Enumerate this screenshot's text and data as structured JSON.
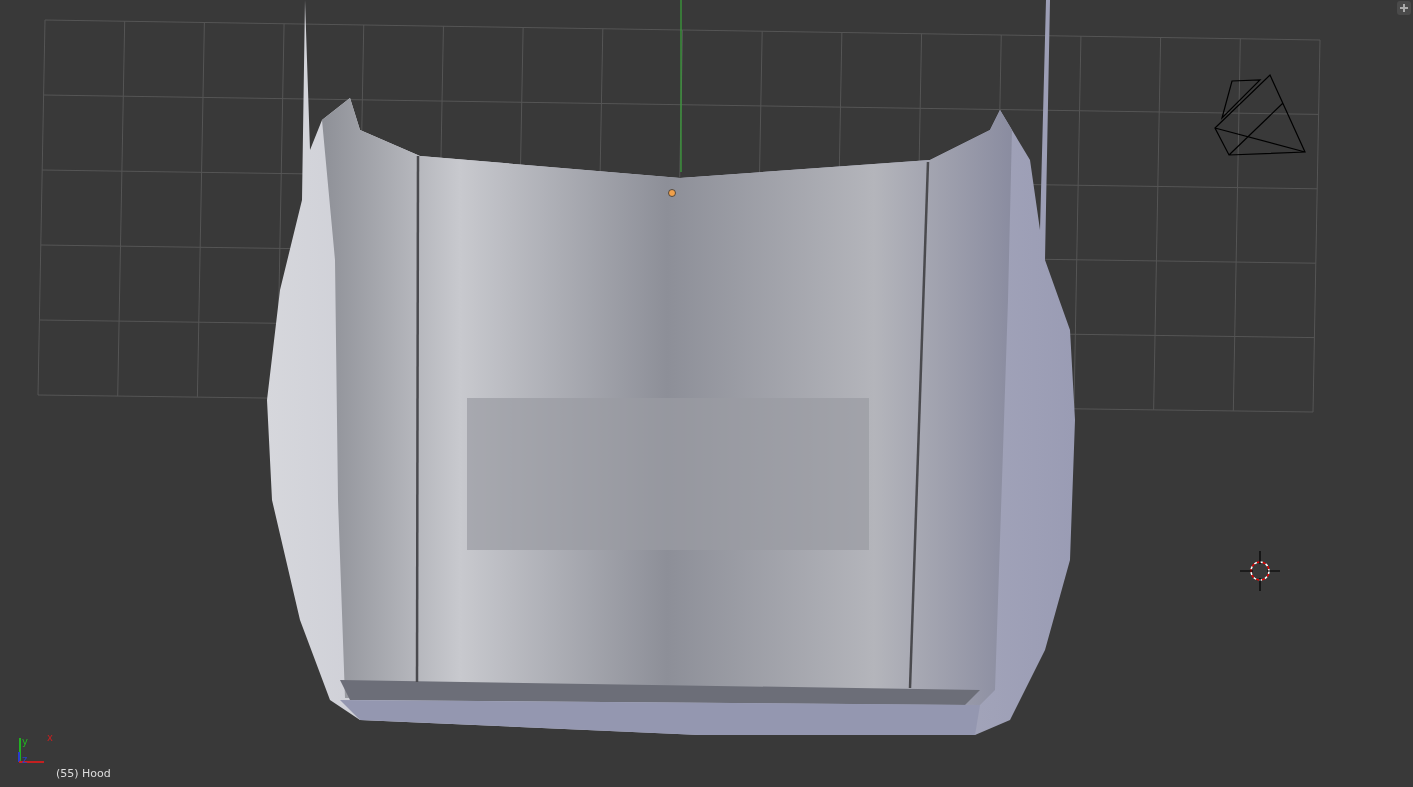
{
  "viewport": {
    "axes": [
      {
        "kind": "y",
        "label": "y"
      },
      {
        "kind": "z",
        "label": "z"
      },
      {
        "kind": "x",
        "label": "x"
      }
    ],
    "object_info": "(55) Hood"
  }
}
